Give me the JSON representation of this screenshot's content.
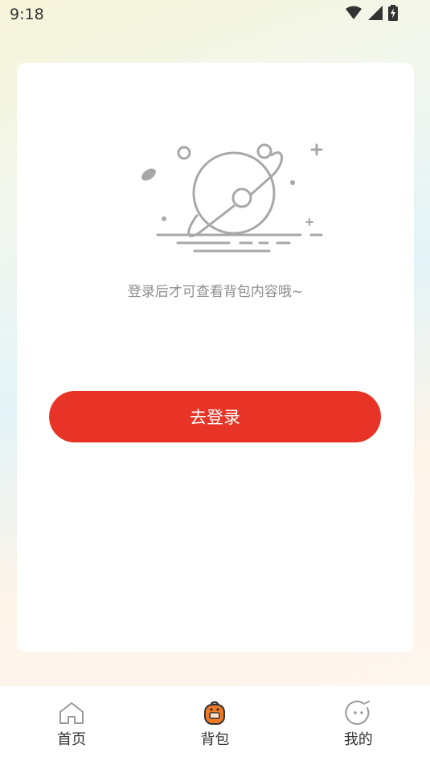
{
  "status_bar": {
    "time": "9:18",
    "icons": [
      "wifi-icon",
      "signal-icon",
      "battery-icon"
    ]
  },
  "card": {
    "message": "登录后才可查看背包内容哦~",
    "login_button_label": "去登录"
  },
  "tabbar": {
    "items": [
      {
        "label": "首页",
        "icon": "home-icon",
        "active": false
      },
      {
        "label": "背包",
        "icon": "backpack-icon",
        "active": true
      },
      {
        "label": "我的",
        "icon": "face-icon",
        "active": false
      }
    ]
  },
  "colors": {
    "accent": "#e83426",
    "active_icon": "#f07a24",
    "icon_gray": "#9a9a9a"
  }
}
